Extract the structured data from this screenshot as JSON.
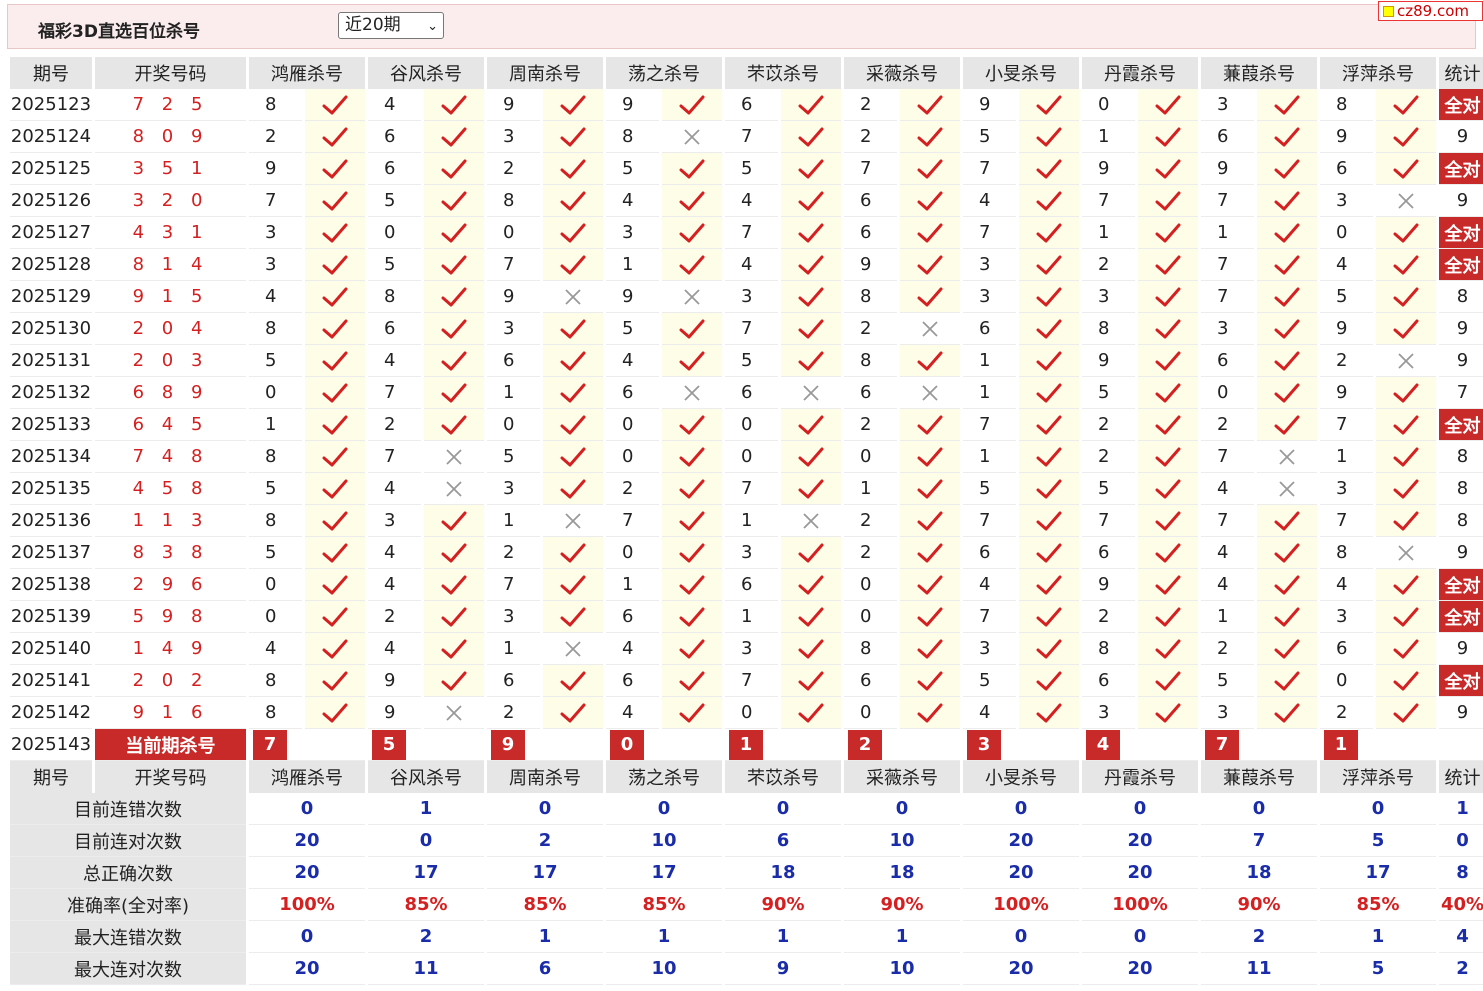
{
  "title": "福彩3D直选百位杀号",
  "period_select": {
    "selected": "近20期"
  },
  "site_logo": "cz89.com",
  "header": {
    "period": "期号",
    "draw": "开奖号码",
    "stat": "统计",
    "experts": [
      "鸿雁杀号",
      "谷风杀号",
      "周南杀号",
      "荡之杀号",
      "芣苡杀号",
      "采薇杀号",
      "小旻杀号",
      "丹霞杀号",
      "蒹葭杀号",
      "浮萍杀号"
    ]
  },
  "rows": [
    {
      "period": "2025123",
      "draw": "7 2 5",
      "kills": [
        "8",
        "4",
        "9",
        "9",
        "6",
        "2",
        "9",
        "0",
        "3",
        "8"
      ],
      "marks": [
        1,
        1,
        1,
        1,
        1,
        1,
        1,
        1,
        1,
        1
      ],
      "stat": "全对"
    },
    {
      "period": "2025124",
      "draw": "8 0 9",
      "kills": [
        "2",
        "6",
        "3",
        "8",
        "7",
        "2",
        "5",
        "1",
        "6",
        "9"
      ],
      "marks": [
        1,
        1,
        1,
        0,
        1,
        1,
        1,
        1,
        1,
        1
      ],
      "stat": "9"
    },
    {
      "period": "2025125",
      "draw": "3 5 1",
      "kills": [
        "9",
        "6",
        "2",
        "5",
        "5",
        "7",
        "7",
        "9",
        "9",
        "6"
      ],
      "marks": [
        1,
        1,
        1,
        1,
        1,
        1,
        1,
        1,
        1,
        1
      ],
      "stat": "全对"
    },
    {
      "period": "2025126",
      "draw": "3 2 0",
      "kills": [
        "7",
        "5",
        "8",
        "4",
        "4",
        "6",
        "4",
        "7",
        "7",
        "3"
      ],
      "marks": [
        1,
        1,
        1,
        1,
        1,
        1,
        1,
        1,
        1,
        0
      ],
      "stat": "9"
    },
    {
      "period": "2025127",
      "draw": "4 3 1",
      "kills": [
        "3",
        "0",
        "0",
        "3",
        "7",
        "6",
        "7",
        "1",
        "1",
        "0"
      ],
      "marks": [
        1,
        1,
        1,
        1,
        1,
        1,
        1,
        1,
        1,
        1
      ],
      "stat": "全对"
    },
    {
      "period": "2025128",
      "draw": "8 1 4",
      "kills": [
        "3",
        "5",
        "7",
        "1",
        "4",
        "9",
        "3",
        "2",
        "7",
        "4"
      ],
      "marks": [
        1,
        1,
        1,
        1,
        1,
        1,
        1,
        1,
        1,
        1
      ],
      "stat": "全对"
    },
    {
      "period": "2025129",
      "draw": "9 1 5",
      "kills": [
        "4",
        "8",
        "9",
        "9",
        "3",
        "8",
        "3",
        "3",
        "7",
        "5"
      ],
      "marks": [
        1,
        1,
        0,
        0,
        1,
        1,
        1,
        1,
        1,
        1
      ],
      "stat": "8"
    },
    {
      "period": "2025130",
      "draw": "2 0 4",
      "kills": [
        "8",
        "6",
        "3",
        "5",
        "7",
        "2",
        "6",
        "8",
        "3",
        "9"
      ],
      "marks": [
        1,
        1,
        1,
        1,
        1,
        0,
        1,
        1,
        1,
        1
      ],
      "stat": "9"
    },
    {
      "period": "2025131",
      "draw": "2 0 3",
      "kills": [
        "5",
        "4",
        "6",
        "4",
        "5",
        "8",
        "1",
        "9",
        "6",
        "2"
      ],
      "marks": [
        1,
        1,
        1,
        1,
        1,
        1,
        1,
        1,
        1,
        0
      ],
      "stat": "9"
    },
    {
      "period": "2025132",
      "draw": "6 8 9",
      "kills": [
        "0",
        "7",
        "1",
        "6",
        "6",
        "6",
        "1",
        "5",
        "0",
        "9"
      ],
      "marks": [
        1,
        1,
        1,
        0,
        0,
        0,
        1,
        1,
        1,
        1
      ],
      "stat": "7"
    },
    {
      "period": "2025133",
      "draw": "6 4 5",
      "kills": [
        "1",
        "2",
        "0",
        "0",
        "0",
        "2",
        "7",
        "2",
        "2",
        "7"
      ],
      "marks": [
        1,
        1,
        1,
        1,
        1,
        1,
        1,
        1,
        1,
        1
      ],
      "stat": "全对"
    },
    {
      "period": "2025134",
      "draw": "7 4 8",
      "kills": [
        "8",
        "7",
        "5",
        "0",
        "0",
        "0",
        "1",
        "2",
        "7",
        "1"
      ],
      "marks": [
        1,
        0,
        1,
        1,
        1,
        1,
        1,
        1,
        0,
        1
      ],
      "stat": "8"
    },
    {
      "period": "2025135",
      "draw": "4 5 8",
      "kills": [
        "5",
        "4",
        "3",
        "2",
        "7",
        "1",
        "5",
        "5",
        "4",
        "3"
      ],
      "marks": [
        1,
        0,
        1,
        1,
        1,
        1,
        1,
        1,
        0,
        1
      ],
      "stat": "8"
    },
    {
      "period": "2025136",
      "draw": "1 1 3",
      "kills": [
        "8",
        "3",
        "1",
        "7",
        "1",
        "2",
        "7",
        "7",
        "7",
        "7"
      ],
      "marks": [
        1,
        1,
        0,
        1,
        0,
        1,
        1,
        1,
        1,
        1
      ],
      "stat": "8"
    },
    {
      "period": "2025137",
      "draw": "8 3 8",
      "kills": [
        "5",
        "4",
        "2",
        "0",
        "3",
        "2",
        "6",
        "6",
        "4",
        "8"
      ],
      "marks": [
        1,
        1,
        1,
        1,
        1,
        1,
        1,
        1,
        1,
        0
      ],
      "stat": "9"
    },
    {
      "period": "2025138",
      "draw": "2 9 6",
      "kills": [
        "0",
        "4",
        "7",
        "1",
        "6",
        "0",
        "4",
        "9",
        "4",
        "4"
      ],
      "marks": [
        1,
        1,
        1,
        1,
        1,
        1,
        1,
        1,
        1,
        1
      ],
      "stat": "全对"
    },
    {
      "period": "2025139",
      "draw": "5 9 8",
      "kills": [
        "0",
        "2",
        "3",
        "6",
        "1",
        "0",
        "7",
        "2",
        "1",
        "3"
      ],
      "marks": [
        1,
        1,
        1,
        1,
        1,
        1,
        1,
        1,
        1,
        1
      ],
      "stat": "全对"
    },
    {
      "period": "2025140",
      "draw": "1 4 9",
      "kills": [
        "4",
        "4",
        "1",
        "4",
        "3",
        "8",
        "3",
        "8",
        "2",
        "6"
      ],
      "marks": [
        1,
        1,
        0,
        1,
        1,
        1,
        1,
        1,
        1,
        1
      ],
      "stat": "9"
    },
    {
      "period": "2025141",
      "draw": "2 0 2",
      "kills": [
        "8",
        "9",
        "6",
        "6",
        "7",
        "6",
        "5",
        "6",
        "5",
        "0"
      ],
      "marks": [
        1,
        1,
        1,
        1,
        1,
        1,
        1,
        1,
        1,
        1
      ],
      "stat": "全对"
    },
    {
      "period": "2025142",
      "draw": "9 1 6",
      "kills": [
        "8",
        "9",
        "2",
        "4",
        "0",
        "0",
        "4",
        "3",
        "3",
        "2"
      ],
      "marks": [
        1,
        0,
        1,
        1,
        1,
        1,
        1,
        1,
        1,
        1
      ],
      "stat": "9"
    }
  ],
  "current": {
    "period": "2025143",
    "label": "当前期杀号",
    "kills": [
      "7",
      "5",
      "9",
      "0",
      "1",
      "2",
      "3",
      "4",
      "7",
      "1"
    ]
  },
  "stats": [
    {
      "label": "目前连错次数",
      "values": [
        "0",
        "1",
        "0",
        "0",
        "0",
        "0",
        "0",
        "0",
        "0",
        "0"
      ],
      "total": "1"
    },
    {
      "label": "目前连对次数",
      "values": [
        "20",
        "0",
        "2",
        "10",
        "6",
        "10",
        "20",
        "20",
        "7",
        "5"
      ],
      "total": "0"
    },
    {
      "label": "总正确次数",
      "values": [
        "20",
        "17",
        "17",
        "17",
        "18",
        "18",
        "20",
        "20",
        "18",
        "17"
      ],
      "total": "8"
    },
    {
      "label": "准确率(全对率)",
      "values": [
        "100%",
        "85%",
        "85%",
        "85%",
        "90%",
        "90%",
        "100%",
        "100%",
        "90%",
        "85%"
      ],
      "total": "40%"
    },
    {
      "label": "最大连错次数",
      "values": [
        "0",
        "2",
        "1",
        "1",
        "1",
        "1",
        "0",
        "0",
        "2",
        "1"
      ],
      "total": "4"
    },
    {
      "label": "最大连对次数",
      "values": [
        "20",
        "11",
        "6",
        "10",
        "9",
        "10",
        "20",
        "20",
        "11",
        "5"
      ],
      "total": "2"
    }
  ],
  "colors": {
    "accent": "#c82a2a",
    "draw": "#d42020",
    "stat_value": "#1a2ca8",
    "highlight": "#fefde8",
    "header_bg": "#e6e6e6",
    "top_bg": "#fbeded"
  }
}
